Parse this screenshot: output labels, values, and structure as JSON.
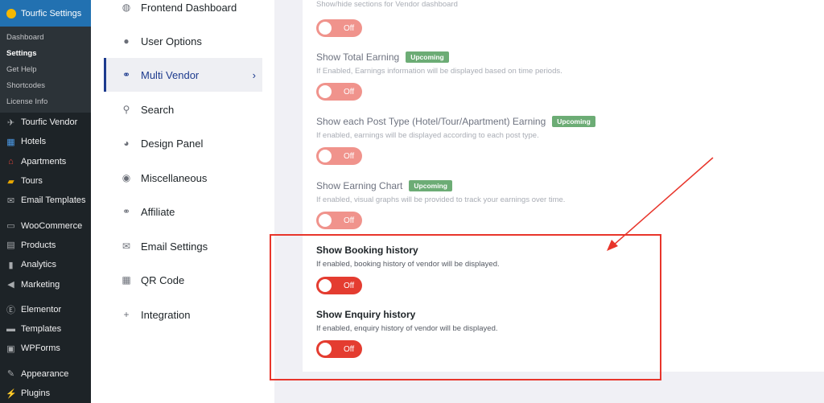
{
  "wp_sidebar": {
    "active": "Tourfic Settings",
    "submenu": [
      "Dashboard",
      "Settings",
      "Get Help",
      "Shortcodes",
      "License Info"
    ],
    "current_submenu": "Settings",
    "items": [
      {
        "label": "Tourfic Vendor",
        "icon": "vendor-icon"
      },
      {
        "label": "Hotels",
        "icon": "building-icon"
      },
      {
        "label": "Apartments",
        "icon": "home-icon"
      },
      {
        "label": "Tours",
        "icon": "suitcase-icon"
      },
      {
        "label": "Email Templates",
        "icon": "mail-icon"
      },
      {
        "label": "WooCommerce",
        "icon": "woo-icon"
      },
      {
        "label": "Products",
        "icon": "archive-icon"
      },
      {
        "label": "Analytics",
        "icon": "bar-chart-icon"
      },
      {
        "label": "Marketing",
        "icon": "megaphone-icon"
      },
      {
        "label": "Elementor",
        "icon": "elementor-icon"
      },
      {
        "label": "Templates",
        "icon": "folder-icon"
      },
      {
        "label": "WPForms",
        "icon": "form-icon"
      },
      {
        "label": "Appearance",
        "icon": "brush-icon"
      },
      {
        "label": "Plugins",
        "icon": "plug-icon"
      }
    ]
  },
  "settings_nav": {
    "items": [
      {
        "label": "Frontend Dashboard",
        "icon": "gauge-icon"
      },
      {
        "label": "User Options",
        "icon": "user-icon"
      },
      {
        "label": "Multi Vendor",
        "icon": "handshake-icon"
      },
      {
        "label": "Search",
        "icon": "search-icon"
      },
      {
        "label": "Design Panel",
        "icon": "palette-icon"
      },
      {
        "label": "Miscellaneous",
        "icon": "globe-icon"
      },
      {
        "label": "Affiliate",
        "icon": "handshake-icon"
      },
      {
        "label": "Email Settings",
        "icon": "mail-icon"
      },
      {
        "label": "QR Code",
        "icon": "qrcode-icon"
      },
      {
        "label": "Integration",
        "icon": "plus-icon"
      }
    ],
    "active": "Multi Vendor",
    "active_chevron": "›"
  },
  "settings": {
    "top_desc": "Show/hide sections for Vendor dashboard",
    "items": [
      {
        "title": "Show Total Earning",
        "badge": "Upcoming",
        "desc": "If Enabled, Earnings information will be displayed based on time periods.",
        "toggle": "Off"
      },
      {
        "title": "Show each Post Type (Hotel/Tour/Apartment) Earning",
        "badge": "Upcoming",
        "desc": "If enabled, earnings will be displayed according to each post type.",
        "toggle": "Off"
      },
      {
        "title": "Show Earning Chart",
        "badge": "Upcoming",
        "desc": "If enabled, visual graphs will be provided to track your earnings over time.",
        "toggle": "Off"
      },
      {
        "title": "Show Booking history",
        "desc": "If enabled, booking history of vendor will be displayed.",
        "toggle": "Off"
      },
      {
        "title": "Show Enquiry history",
        "desc": "If enabled, enquiry history of vendor will be displayed.",
        "toggle": "Off"
      }
    ],
    "top_toggle": "Off"
  },
  "colors": {
    "wp_sidebar_bg": "#1d2327",
    "wp_active": "#2271b1",
    "toggle_off": "#e43c30",
    "badge": "#2f8a3c",
    "annotation": "#e8352b",
    "nav_active": "#1d3b8e"
  }
}
